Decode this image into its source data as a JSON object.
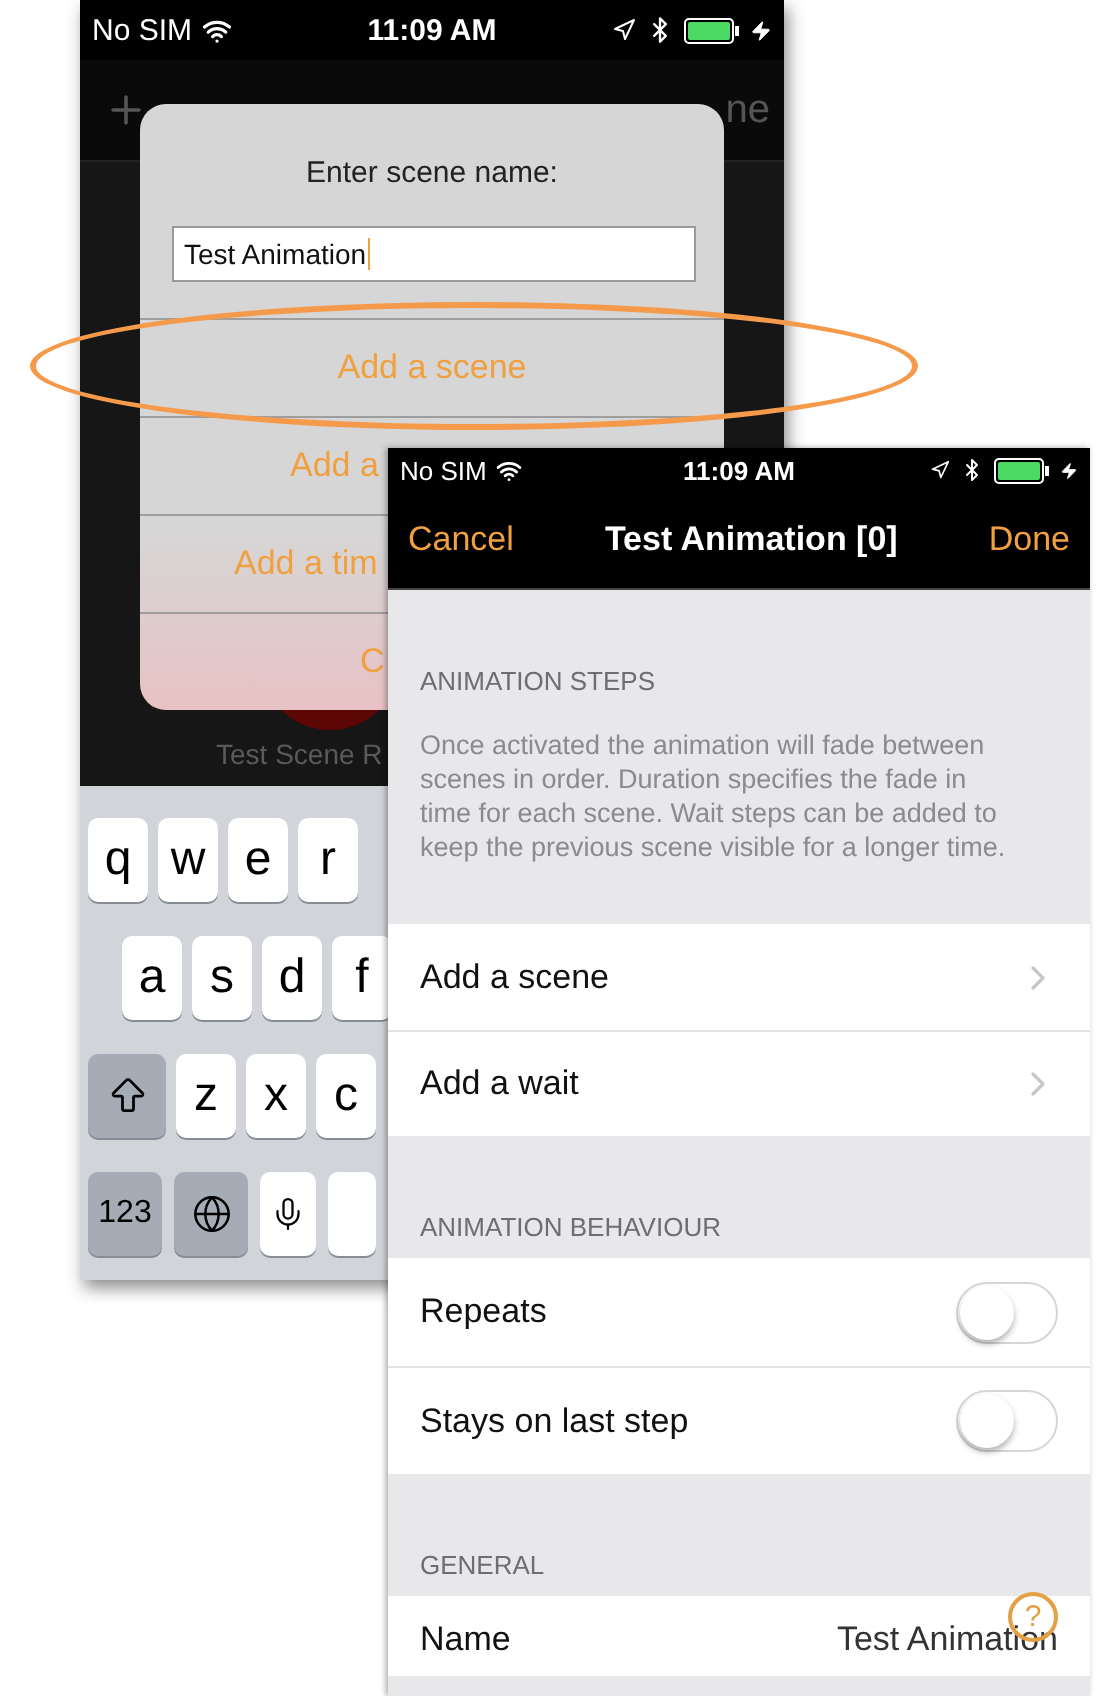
{
  "back_screen": {
    "status_bar": {
      "carrier": "No SIM",
      "time": "11:09 AM"
    },
    "nav_bar": {
      "right_button": "ne"
    },
    "alert": {
      "title": "Enter scene name:",
      "field": {
        "value": "Test Animation"
      },
      "actions": [
        {
          "label": "Add a scene"
        },
        {
          "label": "Add a"
        },
        {
          "label": "Add a tim"
        },
        {
          "label": "C"
        }
      ]
    },
    "highlight": {
      "kind": "ellipse"
    },
    "caption": "Test Scene R",
    "keyboard": {
      "rows": [
        [
          {
            "kind": "letter",
            "label": "q"
          },
          {
            "kind": "letter",
            "label": "w"
          },
          {
            "kind": "letter",
            "label": "e"
          },
          {
            "kind": "letter",
            "label": "r"
          }
        ],
        [
          {
            "kind": "letter",
            "label": "a"
          },
          {
            "kind": "letter",
            "label": "s"
          },
          {
            "kind": "letter",
            "label": "d"
          },
          {
            "kind": "letter",
            "label": "f"
          }
        ],
        [
          {
            "kind": "shift"
          },
          {
            "kind": "letter",
            "label": "z"
          },
          {
            "kind": "letter",
            "label": "x"
          },
          {
            "kind": "letter",
            "label": "c"
          }
        ],
        [
          {
            "kind": "mode",
            "label": "123"
          },
          {
            "kind": "globe"
          },
          {
            "kind": "mic"
          },
          {
            "kind": "space"
          }
        ]
      ]
    }
  },
  "front_screen": {
    "status_bar": {
      "carrier": "No SIM",
      "time": "11:09 AM"
    },
    "nav_bar": {
      "left_button": "Cancel",
      "title": "Test Animation [0]",
      "right_button": "Done"
    },
    "sections": [
      {
        "header": "ANIMATION STEPS",
        "description": "Once activated the animation will fade between scenes in order. Duration specifies the fade in time for each scene. Wait steps can be added to keep the previous scene visible for a longer time.",
        "rows": [
          {
            "kind": "link",
            "label": "Add a scene"
          },
          {
            "kind": "link",
            "label": "Add a wait"
          }
        ]
      },
      {
        "header": "ANIMATION BEHAVIOUR",
        "rows": [
          {
            "kind": "toggle",
            "label": "Repeats",
            "on": false
          },
          {
            "kind": "toggle",
            "label": "Stays on last step",
            "on": false
          }
        ]
      },
      {
        "header": "GENERAL",
        "rows": [
          {
            "kind": "value",
            "label": "Name",
            "value": "Test Animation"
          }
        ]
      }
    ],
    "help_button": "?"
  }
}
